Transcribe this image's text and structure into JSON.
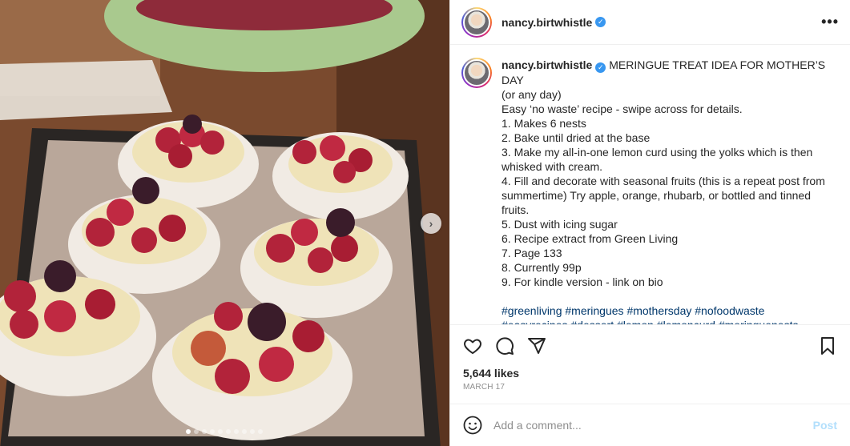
{
  "post": {
    "username": "nancy.birtwhistle",
    "verified_mark": "✓",
    "more_icon": "more-horizontal-icon",
    "caption_lines": [
      "MERINGUE TREAT IDEA FOR MOTHER’S DAY",
      "(or any day)",
      "Easy ‘no waste’ recipe - swipe across for details.",
      "1. Makes 6 nests",
      "2. Bake until dried at the base",
      "3. Make my all-in-one lemon curd using the yolks which is then",
      "whisked with cream.",
      "4. Fill and decorate with seasonal fruits (this is a repeat post from",
      "summertime) Try apple, orange, rhubarb, or bottled and tinned",
      "fruits.",
      "5. Dust with icing sugar",
      "6. Recipe extract from Green Living",
      "7. Page 133",
      "8. Currently 99p",
      "9. For kindle version - link on bio"
    ],
    "hashtags_line1": [
      "#greenliving",
      "#meringues",
      "#mothersday",
      "#nofoodwaste"
    ],
    "hashtags_line2": [
      "#easyrecipes",
      "#dessert",
      "#lemon",
      "#lemoncurd",
      "#meringuenests"
    ],
    "likes": "5,644 likes",
    "date": "MARCH 17",
    "comment_placeholder": "Add a comment...",
    "post_label": "Post"
  },
  "carousel": {
    "total_images": 10,
    "active_index": 0,
    "next_arrow": "›"
  },
  "colors": {
    "link": "#00376b",
    "verified": "#3897f0",
    "post_disabled": "#b2dffc"
  }
}
